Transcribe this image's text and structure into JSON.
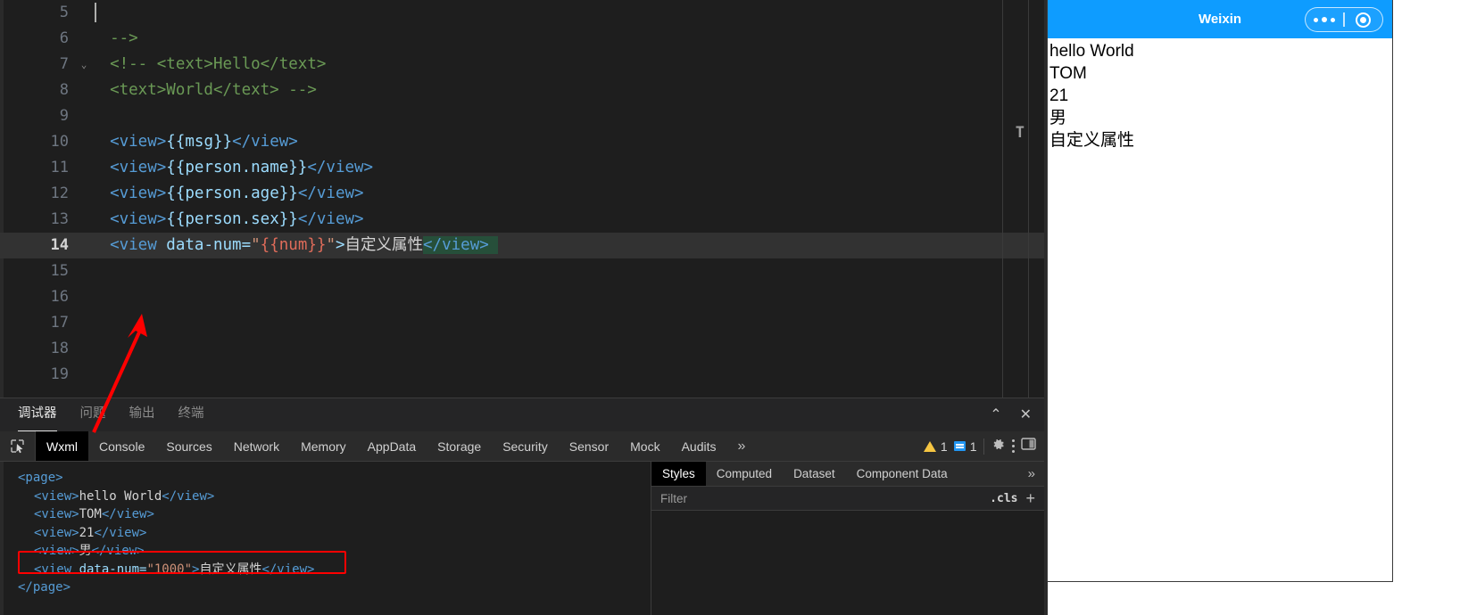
{
  "editor": {
    "language": "wxml",
    "lines": [
      {
        "num": "5",
        "folded": false,
        "current": false,
        "tokens": []
      },
      {
        "num": "6",
        "folded": false,
        "current": false,
        "tokens": [
          {
            "t": "comment",
            "v": "  -->"
          }
        ]
      },
      {
        "num": "7",
        "folded": true,
        "current": false,
        "tokens": [
          {
            "t": "comment",
            "v": "  <!-- <text>Hello</text>"
          }
        ]
      },
      {
        "num": "8",
        "folded": false,
        "current": false,
        "tokens": [
          {
            "t": "comment",
            "v": "  <text>World</text> -->"
          }
        ]
      },
      {
        "num": "9",
        "folded": false,
        "current": false,
        "tokens": []
      },
      {
        "num": "10",
        "folded": false,
        "current": false,
        "tokens": [
          {
            "t": "plain",
            "v": "  "
          },
          {
            "t": "tag",
            "v": "<view>"
          },
          {
            "t": "mustache",
            "v": "{{msg}}"
          },
          {
            "t": "tag",
            "v": "</view>"
          }
        ]
      },
      {
        "num": "11",
        "folded": false,
        "current": false,
        "tokens": [
          {
            "t": "plain",
            "v": "  "
          },
          {
            "t": "tag",
            "v": "<view>"
          },
          {
            "t": "mustache",
            "v": "{{person.name}}"
          },
          {
            "t": "tag",
            "v": "</view>"
          }
        ]
      },
      {
        "num": "12",
        "folded": false,
        "current": false,
        "tokens": [
          {
            "t": "plain",
            "v": "  "
          },
          {
            "t": "tag",
            "v": "<view>"
          },
          {
            "t": "mustache",
            "v": "{{person.age}}"
          },
          {
            "t": "tag",
            "v": "</view>"
          }
        ]
      },
      {
        "num": "13",
        "folded": false,
        "current": false,
        "tokens": [
          {
            "t": "plain",
            "v": "  "
          },
          {
            "t": "tag",
            "v": "<view>"
          },
          {
            "t": "mustache",
            "v": "{{person.sex}}"
          },
          {
            "t": "tag",
            "v": "</view>"
          }
        ]
      },
      {
        "num": "14",
        "folded": false,
        "current": true,
        "tokens": [
          {
            "t": "plain",
            "v": "  "
          },
          {
            "t": "tag",
            "v": "<view"
          },
          {
            "t": "attr",
            "v": " data-num="
          },
          {
            "t": "str",
            "v": "\""
          },
          {
            "t": "str-red",
            "v": "{{num}}"
          },
          {
            "t": "str",
            "v": "\""
          },
          {
            "t": "attr",
            "v": ">"
          },
          {
            "t": "text",
            "v": "自定义属性"
          },
          {
            "t": "tag-sel",
            "v": "</view>"
          },
          {
            "t": "sel-caret",
            "v": ""
          }
        ]
      },
      {
        "num": "15",
        "folded": false,
        "current": false,
        "tokens": []
      },
      {
        "num": "16",
        "folded": false,
        "current": false,
        "tokens": []
      },
      {
        "num": "17",
        "folded": false,
        "current": false,
        "tokens": []
      },
      {
        "num": "18",
        "folded": false,
        "current": false,
        "tokens": []
      },
      {
        "num": "19",
        "folded": false,
        "current": false,
        "tokens": []
      }
    ],
    "overview_marker": "T"
  },
  "debugger_panel": {
    "tabs": [
      {
        "label": "调试器",
        "active": true
      },
      {
        "label": "问题",
        "active": false
      },
      {
        "label": "输出",
        "active": false
      },
      {
        "label": "终端",
        "active": false
      }
    ],
    "collapse_icon": "chevron-up-icon",
    "close_icon": "close-icon",
    "collapse_glyph": "⌃",
    "close_glyph": "✕"
  },
  "devtools": {
    "inspect_icon": "inspect-element-icon",
    "tabs": [
      {
        "label": "Wxml",
        "active": true
      },
      {
        "label": "Console",
        "active": false
      },
      {
        "label": "Sources",
        "active": false
      },
      {
        "label": "Network",
        "active": false
      },
      {
        "label": "Memory",
        "active": false
      },
      {
        "label": "AppData",
        "active": false
      },
      {
        "label": "Storage",
        "active": false
      },
      {
        "label": "Security",
        "active": false
      },
      {
        "label": "Sensor",
        "active": false
      },
      {
        "label": "Mock",
        "active": false
      },
      {
        "label": "Audits",
        "active": false
      }
    ],
    "overflow_glyph": "»",
    "warnings_count": "1",
    "messages_count": "1",
    "settings_icon": "gear-icon",
    "more_icon": "kebab-menu-icon",
    "dock_icon": "dock-side-icon"
  },
  "wxml_tree": {
    "lines": [
      {
        "indent": 0,
        "segments": [
          {
            "t": "tag",
            "v": "<page>"
          }
        ],
        "highlighted": false
      },
      {
        "indent": 1,
        "segments": [
          {
            "t": "tag",
            "v": "<view>"
          },
          {
            "t": "txt",
            "v": "hello World"
          },
          {
            "t": "tag",
            "v": "</view>"
          }
        ],
        "highlighted": false
      },
      {
        "indent": 1,
        "segments": [
          {
            "t": "tag",
            "v": "<view>"
          },
          {
            "t": "txt",
            "v": "TOM"
          },
          {
            "t": "tag",
            "v": "</view>"
          }
        ],
        "highlighted": false
      },
      {
        "indent": 1,
        "segments": [
          {
            "t": "tag",
            "v": "<view>"
          },
          {
            "t": "txt",
            "v": "21"
          },
          {
            "t": "tag",
            "v": "</view>"
          }
        ],
        "highlighted": false
      },
      {
        "indent": 1,
        "segments": [
          {
            "t": "tag",
            "v": "<view>"
          },
          {
            "t": "txt",
            "v": "男"
          },
          {
            "t": "tag",
            "v": "</view>"
          }
        ],
        "highlighted": false
      },
      {
        "indent": 1,
        "segments": [
          {
            "t": "tag",
            "v": "<view "
          },
          {
            "t": "attr",
            "v": "data-num="
          },
          {
            "t": "val",
            "v": "\"1000\""
          },
          {
            "t": "tag",
            "v": ">"
          },
          {
            "t": "txt",
            "v": "自定义属性"
          },
          {
            "t": "tag",
            "v": "</view>"
          }
        ],
        "highlighted": true
      },
      {
        "indent": 0,
        "segments": [
          {
            "t": "tag",
            "v": "</page>"
          }
        ],
        "highlighted": false
      }
    ],
    "highlight_color": "#ff0000"
  },
  "styles_panel": {
    "tabs": [
      {
        "label": "Styles",
        "active": true
      },
      {
        "label": "Computed",
        "active": false
      },
      {
        "label": "Dataset",
        "active": false
      },
      {
        "label": "Component Data",
        "active": false
      }
    ],
    "overflow_glyph": "»",
    "filter_placeholder": "Filter",
    "cls_label": ".cls",
    "add_rule_glyph": "+"
  },
  "simulator": {
    "title": "Weixin",
    "navbar_color": "#0E9CFF",
    "capsule": {
      "more_icon": "more-dots-icon",
      "target_icon": "target-circle-icon"
    },
    "page_lines": [
      "hello World",
      "TOM",
      "21",
      "男",
      "自定义属性"
    ]
  },
  "annotation": {
    "arrow_color": "#ff0000",
    "arrow_name": "red-pointer-arrow"
  }
}
